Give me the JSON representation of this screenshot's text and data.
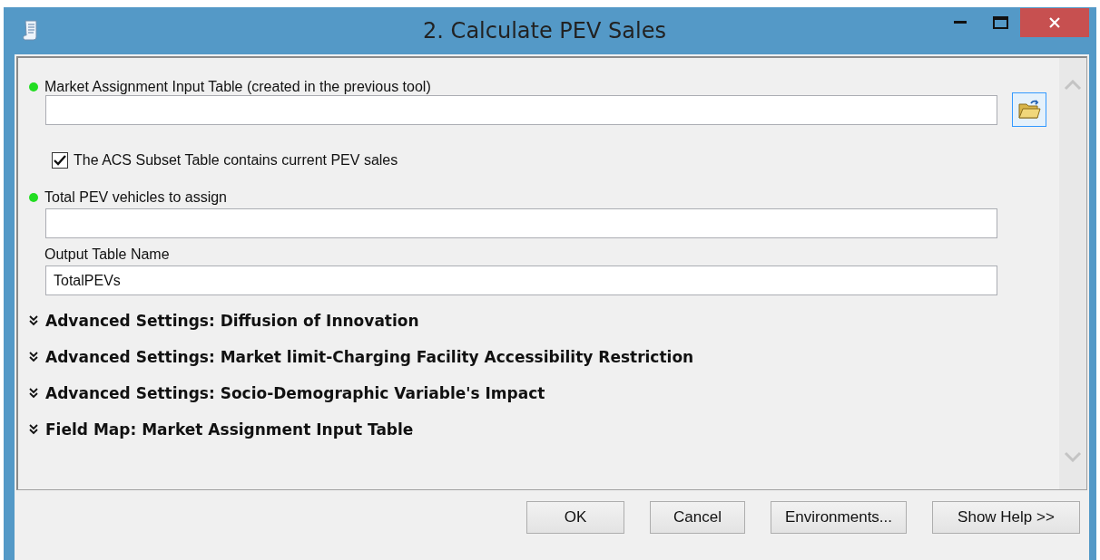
{
  "window": {
    "title": "2. Calculate PEV Sales"
  },
  "parameters": [
    {
      "kind": "field",
      "label": "Market Assignment Input Table (created in the previous tool)",
      "required": true,
      "browse": true
    },
    {
      "kind": "checkbox",
      "label": "The ACS Subset Table contains current PEV sales",
      "checked": true
    },
    {
      "kind": "field",
      "label": "Total PEV vehicles to assign",
      "required": true,
      "browse": false
    },
    {
      "kind": "field",
      "label": "Output Table Name",
      "required": false,
      "browse": false,
      "value": "TotalPEVs"
    },
    {
      "kind": "section",
      "label": "Advanced Settings: Diffusion of Innovation",
      "expanded": false
    },
    {
      "kind": "section",
      "label": "Advanced Settings: Market limit-Charging Facility Accessibility Restriction",
      "expanded": false
    },
    {
      "kind": "section",
      "label": "Advanced Settings: Socio-Demographic Variable's Impact",
      "expanded": false
    },
    {
      "kind": "section",
      "label": "Field Map: Market Assignment Input Table",
      "expanded": false
    }
  ],
  "buttons": [
    "OK",
    "Cancel",
    "Environments...",
    "Show Help >>"
  ]
}
